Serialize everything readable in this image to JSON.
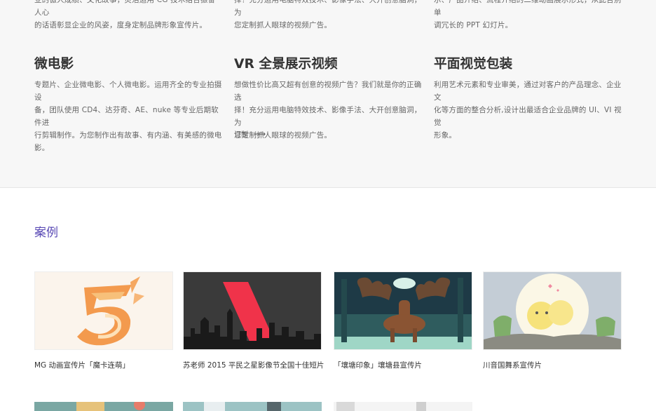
{
  "services": {
    "top_row": [
      {
        "desc_l1": "业的傲人成绩、文化故事，灵活运用 CG 技术结合振奋人心",
        "desc_l2": "的话语彰显企业的风姿，度身定制品牌形象宣传片。"
      },
      {
        "desc_l1": "择！充分运用电脑特效技术、影像手法、大开创意脑洞，为",
        "desc_l2": "您定制抓人眼球的视频广告。"
      },
      {
        "desc_l1": "示、产品介绍、流程介绍的二维动画展示形式，从此告别单",
        "desc_l2": "调冗长的 PPT 幻灯片。"
      }
    ],
    "items": [
      {
        "title": "微电影",
        "desc_l1": "专题片、企业微电影、个人微电影。运用齐全的专业拍摄设",
        "desc_l2": "备，团队使用 CD4、达芬奇、AE、nuke 等专业后期软件进",
        "desc_l3": "行剪辑制作。为您制作出有故事、有内涵、有美感的微电",
        "desc_l4": "影。"
      },
      {
        "title": "VR 全景展示视频",
        "desc_l1": "想做性价比高又超有创意的视频广告？我们就是你的正确选",
        "desc_l2": "择！充分运用电脑特效技术、影像手法、大开创意脑洞，为",
        "desc_l3": "您定制抓人眼球的视频广告。",
        "link_label": "订制",
        "link_icon": "arrow-right-icon"
      },
      {
        "title": "平面视觉包装",
        "desc_l1": "利用艺术元素和专业审美，通过对客户的产品理念、企业文",
        "desc_l2": "化等方面的整合分析,设计出最适合企业品牌的 UI、VI 视觉",
        "desc_l3": "形象。"
      }
    ]
  },
  "cases": {
    "title": "案例",
    "accent_color": "#5a4ab5",
    "items": [
      {
        "caption": "MG 动画宣传片「魔卡连萌」"
      },
      {
        "caption": "苏老师 2015 平民之星影像节全国十佳短片"
      },
      {
        "caption": "「壤塘印象」壤塘县宣传片"
      },
      {
        "caption": "川音国舞系宣传片"
      }
    ]
  }
}
